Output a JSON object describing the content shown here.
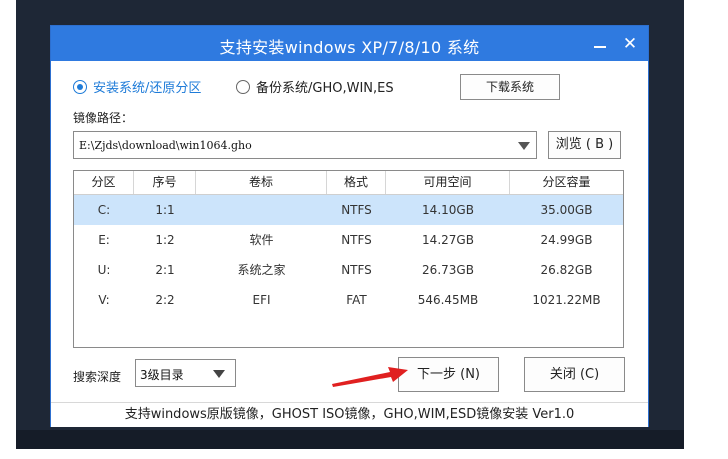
{
  "window": {
    "title": "支持安装windows XP/7/8/10 系统"
  },
  "mode": {
    "option1": "安装系统/还原分区",
    "option2": "备份系统/GHO,WIN,ES",
    "download_button": "下载系统"
  },
  "image_path": {
    "label": "镜像路径：",
    "value": "E:\\Zjds\\download\\win1064.gho",
    "browse_button": "浏览 ( B )"
  },
  "partitions": {
    "columns": [
      "分区",
      "序号",
      "卷标",
      "格式",
      "可用空间",
      "分区容量"
    ],
    "rows": [
      {
        "drive": "C:",
        "index": "1:1",
        "label": "",
        "format": "NTFS",
        "free": "14.10GB",
        "size": "35.00GB"
      },
      {
        "drive": "E:",
        "index": "1:2",
        "label": "软件",
        "format": "NTFS",
        "free": "14.27GB",
        "size": "24.99GB"
      },
      {
        "drive": "U:",
        "index": "2:1",
        "label": "系统之家",
        "format": "NTFS",
        "free": "26.73GB",
        "size": "26.82GB"
      },
      {
        "drive": "V:",
        "index": "2:2",
        "label": "EFI",
        "format": "FAT",
        "free": "546.45MB",
        "size": "1021.22MB"
      }
    ]
  },
  "bottom": {
    "depth_label": "搜索深度",
    "depth_value": "3级目录",
    "next_button": "下一步 (N)",
    "close_button": "关闭 (C)"
  },
  "footer": {
    "text": "支持windows原版镜像，GHOST ISO镜像，GHO,WIM,ESD镜像安装 Ver1.0"
  },
  "colors": {
    "titlebar": "#2f7ae0",
    "selected_row": "#cce4fb",
    "accent": "#1e7bd8",
    "arrow": "#e02020"
  }
}
